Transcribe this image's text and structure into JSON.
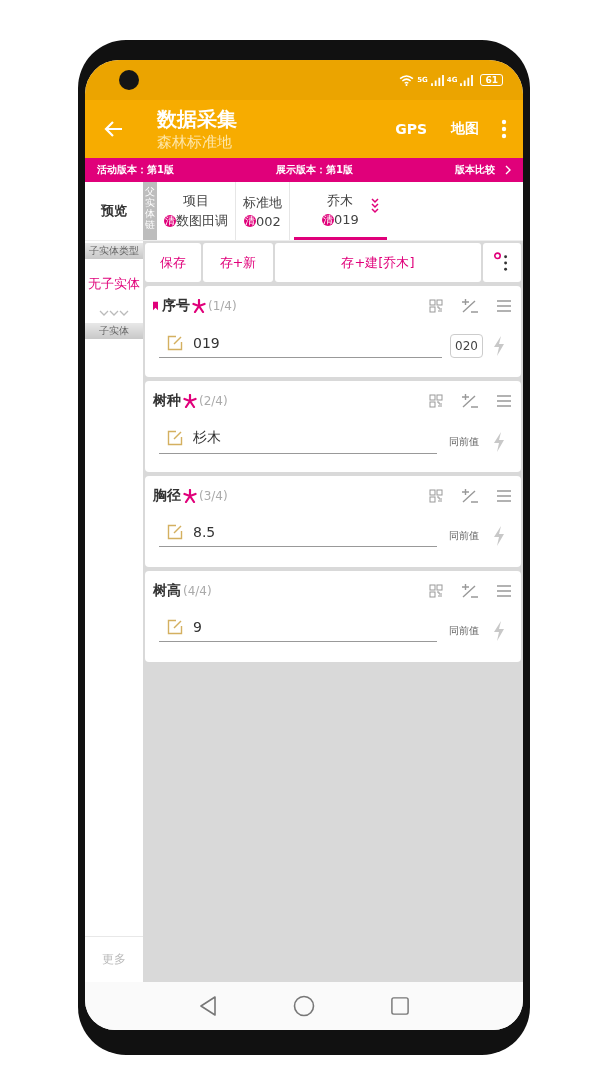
{
  "status_bar": {
    "network_1": "5G",
    "network_2": "4G",
    "battery": "61"
  },
  "app_bar": {
    "title": "数据采集",
    "subtitle": "森林标准地",
    "actions": [
      "GPS",
      "地图"
    ]
  },
  "version_bar": {
    "active": "活动版本：第1版",
    "shown": "展示版本：第1版",
    "compare": "版本比较"
  },
  "preview": "预览",
  "chain_label": "父实体链",
  "chain_tabs": [
    {
      "title": "项目",
      "badge": "清",
      "value": "数图田调",
      "selected": false
    },
    {
      "title": "标准地",
      "badge": "清",
      "value": "002",
      "selected": false
    },
    {
      "title": "乔木",
      "badge": "清",
      "value": "019",
      "selected": true
    }
  ],
  "sidebar": {
    "type_label": "子实体类型",
    "empty": "无子实体",
    "child_label": "子实体",
    "more": "更多"
  },
  "buttons": [
    "保存",
    "存+新",
    "存+建[乔木]"
  ],
  "fields": [
    {
      "label": "序号",
      "bookmarked": true,
      "required": true,
      "position": "(1/4)",
      "value": "019",
      "kind": "next",
      "side": "020"
    },
    {
      "label": "树种",
      "bookmarked": false,
      "required": true,
      "position": "(2/4)",
      "value": "杉木",
      "kind": "same",
      "side": "同前值"
    },
    {
      "label": "胸径",
      "bookmarked": false,
      "required": true,
      "position": "(3/4)",
      "value": "8.5",
      "kind": "same",
      "side": "同前值"
    },
    {
      "label": "树高",
      "bookmarked": false,
      "required": false,
      "position": "(4/4)",
      "value": "9",
      "kind": "same",
      "side": "同前值"
    }
  ]
}
